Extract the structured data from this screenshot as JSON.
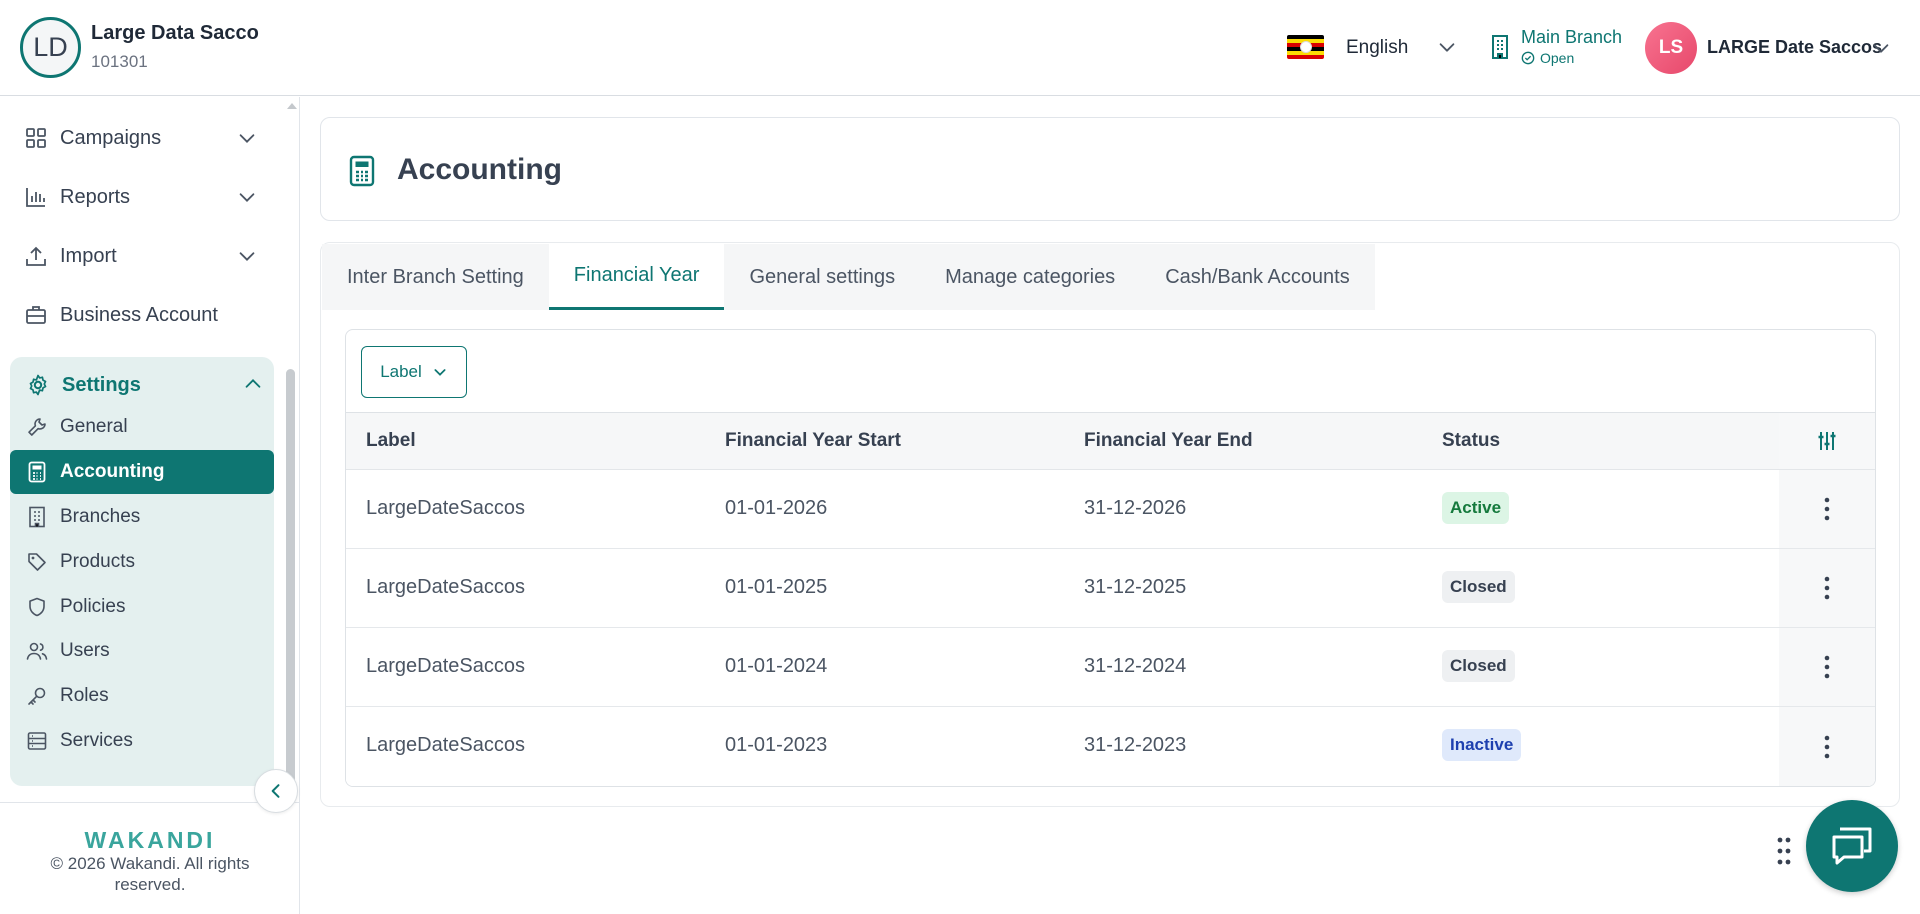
{
  "header": {
    "org_initials": "LD",
    "org_name": "Large Data Sacco",
    "org_code": "101301",
    "language": "English",
    "branch_name": "Main Branch",
    "branch_status": "Open",
    "user_initials": "LS",
    "user_name": "LARGE Date Saccos"
  },
  "sidebar": {
    "items": [
      {
        "label": "Campaigns",
        "icon": "grid-icon"
      },
      {
        "label": "Reports",
        "icon": "bar-chart-icon"
      },
      {
        "label": "Import",
        "icon": "upload-icon"
      },
      {
        "label": "Business Account",
        "icon": "briefcase-icon"
      }
    ],
    "settings_label": "Settings",
    "sub_items": [
      {
        "label": "General",
        "icon": "wrench-icon"
      },
      {
        "label": "Accounting",
        "icon": "calculator-icon",
        "active": true
      },
      {
        "label": "Branches",
        "icon": "building-icon"
      },
      {
        "label": "Products",
        "icon": "tag-icon"
      },
      {
        "label": "Policies",
        "icon": "shield-icon"
      },
      {
        "label": "Users",
        "icon": "users-icon"
      },
      {
        "label": "Roles",
        "icon": "key-icon"
      },
      {
        "label": "Services",
        "icon": "server-icon"
      }
    ],
    "brand": "WAKANDI",
    "copyright": "© 2026 Wakandi. All rights reserved."
  },
  "page": {
    "title": "Accounting",
    "tabs": [
      "Inter Branch Setting",
      "Financial Year",
      "General settings",
      "Manage categories",
      "Cash/Bank Accounts"
    ],
    "active_tab": "Financial Year",
    "filter_label": "Label"
  },
  "table": {
    "columns": [
      "Label",
      "Financial Year Start",
      "Financial Year End",
      "Status"
    ],
    "rows": [
      {
        "label": "LargeDateSaccos",
        "start": "01-01-2026",
        "end": "31-12-2026",
        "status": "Active"
      },
      {
        "label": "LargeDateSaccos",
        "start": "01-01-2025",
        "end": "31-12-2025",
        "status": "Closed"
      },
      {
        "label": "LargeDateSaccos",
        "start": "01-01-2024",
        "end": "31-12-2024",
        "status": "Closed"
      },
      {
        "label": "LargeDateSaccos",
        "start": "01-01-2023",
        "end": "31-12-2023",
        "status": "Inactive"
      }
    ]
  },
  "colors": {
    "primary": "#0e7672",
    "active_bg": "#dcf5e5",
    "active_fg": "#157a3d",
    "closed_bg": "#eef0f2",
    "closed_fg": "#374151",
    "inactive_bg": "#dfe9fb",
    "inactive_fg": "#1e40af"
  }
}
